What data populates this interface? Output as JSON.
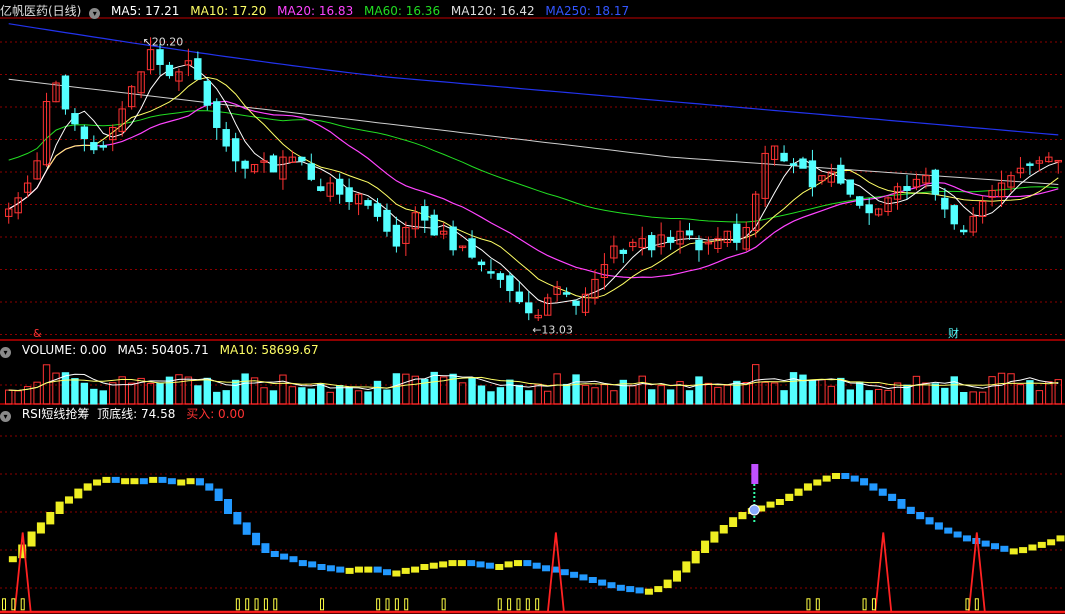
{
  "title": "亿帆医药(日线)",
  "price_panel": {
    "indicators": [
      {
        "label": "MA5: 17.21",
        "color": "#ffffff"
      },
      {
        "label": "MA10: 17.20",
        "color": "#ffff66"
      },
      {
        "label": "MA20: 16.83",
        "color": "#ff44ff"
      },
      {
        "label": "MA60: 16.36",
        "color": "#22dd22"
      },
      {
        "label": "MA120: 16.42",
        "color": "#dddddd"
      },
      {
        "label": "MA250: 18.17",
        "color": "#3355ff"
      }
    ],
    "high_label": "20.20",
    "low_label": "13.03",
    "markers": [
      "&",
      "财"
    ]
  },
  "volume_panel": {
    "indicators": [
      {
        "label": "VOLUME: 0.00",
        "color": "#ffffff"
      },
      {
        "label": "MA5: 50405.71",
        "color": "#ffffff"
      },
      {
        "label": "MA10: 58699.67",
        "color": "#ffff66"
      }
    ]
  },
  "rsi_panel": {
    "indicators": [
      {
        "label": "RSI短线抢筹",
        "color": "#ffffff"
      },
      {
        "label": "顶底线: 74.58",
        "color": "#ffffff"
      },
      {
        "label": "买入: 0.00",
        "color": "#ff3333"
      }
    ]
  },
  "colors": {
    "up": "#ff3333",
    "down": "#54ffff",
    "grid": "#8b0000",
    "ma250": "#2233ee"
  },
  "chart_data": {
    "type": "candlestick",
    "y_range": [
      12.5,
      21.0
    ],
    "closes": [
      15.9,
      16.2,
      16.6,
      17.2,
      18.8,
      19.3,
      18.6,
      18.2,
      17.8,
      17.5,
      17.6,
      18.1,
      18.6,
      19.2,
      19.6,
      20.2,
      19.8,
      19.5,
      19.6,
      19.9,
      19.4,
      18.7,
      18.1,
      17.6,
      17.2,
      17.0,
      17.1,
      17.2,
      16.9,
      17.3,
      17.3,
      17.2,
      16.7,
      16.4,
      16.6,
      16.3,
      16.1,
      16.3,
      16.0,
      15.7,
      15.3,
      14.9,
      15.4,
      15.8,
      15.6,
      15.2,
      15.3,
      14.8,
      14.9,
      14.6,
      14.4,
      14.2,
      14.0,
      13.7,
      13.4,
      13.1,
      13.03,
      13.5,
      13.8,
      13.6,
      13.3,
      13.6,
      14.0,
      14.4,
      14.9,
      14.7,
      15.0,
      15.1,
      14.8,
      15.2,
      15.0,
      15.3,
      15.2,
      14.8,
      15.0,
      15.1,
      15.3,
      15.0,
      15.4,
      16.3,
      17.4,
      17.6,
      17.2,
      17.1,
      17.0,
      16.5,
      16.8,
      16.9,
      16.6,
      16.3,
      16.0,
      15.8,
      15.9,
      16.2,
      16.5,
      16.4,
      16.7,
      16.8,
      16.3,
      15.9,
      15.5,
      15.3,
      15.7,
      16.1,
      16.4,
      16.6,
      16.8,
      17.0,
      17.1,
      17.2,
      17.3,
      17.21
    ],
    "rsi_values": [
      36,
      36,
      45,
      55,
      62,
      70,
      78,
      82,
      88,
      92,
      95,
      97,
      96,
      96,
      96,
      95,
      97,
      96,
      95,
      95,
      96,
      92,
      88,
      80,
      70,
      62,
      54,
      46,
      40,
      38,
      36,
      33,
      32,
      30,
      29,
      28,
      27,
      27,
      28,
      28,
      26,
      25,
      25,
      27,
      28,
      30,
      31,
      32,
      33,
      33,
      32,
      31,
      30,
      30,
      32,
      33,
      31,
      29,
      28,
      26,
      24,
      22,
      20,
      18,
      16,
      14,
      13,
      12,
      11,
      11,
      13,
      18,
      25,
      32,
      40,
      48,
      55,
      60,
      66,
      70,
      73,
      75,
      78,
      80,
      84,
      88,
      92,
      95,
      98,
      100,
      98,
      96,
      92,
      88,
      84,
      80,
      74,
      70,
      66,
      62,
      58,
      55,
      52,
      50,
      48,
      46,
      44,
      42,
      42,
      43,
      45,
      47,
      49,
      52
    ]
  }
}
